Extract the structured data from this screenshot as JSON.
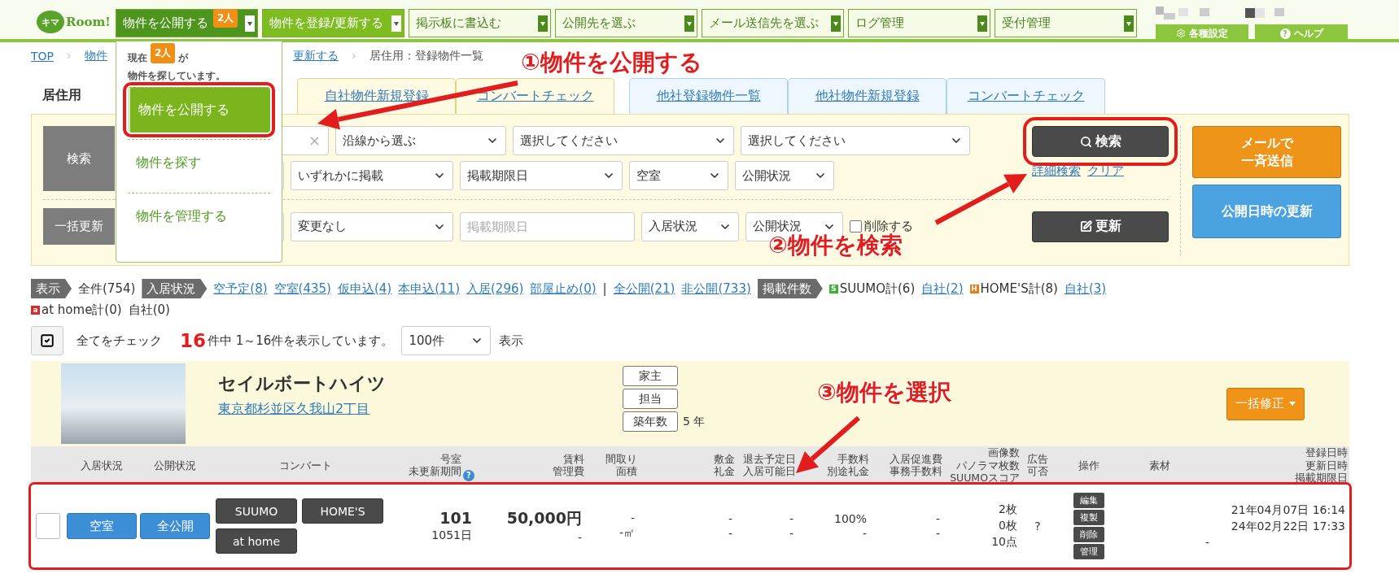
{
  "logo": {
    "mark": "キマ",
    "word": "Room!"
  },
  "nav": [
    {
      "label": "物件を公開する",
      "kind": "solid",
      "selected": true,
      "badge": "2人"
    },
    {
      "label": "物件を登録/更新する",
      "kind": "solid",
      "selected": false
    },
    {
      "label": "掲示板に書込む",
      "kind": "outline",
      "selected": false
    },
    {
      "label": "公開先を選ぶ",
      "kind": "outline",
      "selected": false
    },
    {
      "label": "メール送信先を選ぶ",
      "kind": "outline",
      "selected": false
    },
    {
      "label": "ログ管理",
      "kind": "outline",
      "selected": false
    },
    {
      "label": "受付管理",
      "kind": "outline",
      "selected": false
    }
  ],
  "utility": [
    {
      "label": "各種設定",
      "kind": "settings"
    },
    {
      "label": "ヘルプ",
      "kind": "help",
      "icon": "?"
    }
  ],
  "dropdown": {
    "status_before": "現在",
    "badge": "2人",
    "status_after": "が",
    "status_line2": "物件を探しています。",
    "items": [
      {
        "label": "物件を公開する",
        "selected": true,
        "highlighted": true
      },
      {
        "label": "物件を探す",
        "selected": false,
        "highlighted": false
      },
      {
        "label": "物件を管理する",
        "selected": false,
        "highlighted": false
      }
    ]
  },
  "breadcrumb": [
    {
      "label": "TOP",
      "kind": "link"
    },
    {
      "label": "物件",
      "kind": "link"
    },
    {
      "label": "更新する",
      "kind": "link"
    },
    {
      "label": "居住用：登録物件一覧",
      "kind": "current"
    }
  ],
  "section_title": "居住用",
  "tabs": [
    {
      "label": "自社物件新規登録",
      "kind": "own"
    },
    {
      "label": "コンバートチェック",
      "kind": "own"
    },
    {
      "label": "他社登録物件一覧",
      "kind": "other"
    },
    {
      "label": "他社物件新規登録",
      "kind": "other"
    },
    {
      "label": "コンバートチェック",
      "kind": "other"
    }
  ],
  "search": {
    "label": "検索",
    "rows": [
      {
        "fields": [
          {
            "kind": "clearable"
          },
          {
            "kind": "select",
            "value": "沿線から選ぶ"
          },
          {
            "kind": "select",
            "value": "選択してください"
          },
          {
            "kind": "select",
            "value": "選択してください"
          }
        ]
      },
      {
        "fields": [
          {
            "kind": "select"
          },
          {
            "kind": "select",
            "value": "いずれかに掲載"
          },
          {
            "kind": "select",
            "value": "掲載期限日"
          },
          {
            "kind": "select",
            "value": "空室"
          },
          {
            "kind": "select",
            "value": "公開状況"
          }
        ]
      }
    ],
    "button": {
      "label": "検索",
      "highlighted": true
    },
    "links": [
      "詳細検索",
      "クリア"
    ]
  },
  "bulk": {
    "label": "一括更新",
    "fields": [
      {
        "kind": "select"
      },
      {
        "kind": "select",
        "value": "変更なし"
      },
      {
        "kind": "date",
        "placeholder": "掲載期限日"
      },
      {
        "kind": "select",
        "value": "入居状況"
      },
      {
        "kind": "select",
        "value": "公開状況"
      },
      {
        "kind": "checkbox",
        "label": "削除する",
        "checked": false
      }
    ],
    "button": {
      "label": "更新"
    }
  },
  "mail_button": {
    "lines": [
      "メールで",
      "一斉送信"
    ]
  },
  "publish_date_button": {
    "label": "公開日時の更新"
  },
  "status_lines": [
    [
      {
        "kind": "tag",
        "text": "表示"
      },
      {
        "kind": "text",
        "text": "全件(754)"
      },
      {
        "kind": "tag",
        "text": "入居状況"
      },
      {
        "kind": "link",
        "text": "空予定(8)"
      },
      {
        "kind": "link",
        "text": "空室(435)"
      },
      {
        "kind": "link",
        "text": "仮申込(4)"
      },
      {
        "kind": "link",
        "text": "本申込(11)"
      },
      {
        "kind": "link",
        "text": "入居(296)"
      },
      {
        "kind": "link",
        "text": "部屋止め(0)"
      },
      {
        "kind": "divider",
        "text": "|"
      },
      {
        "kind": "link",
        "text": "全公開(21)"
      },
      {
        "kind": "link",
        "text": "非公開(733)"
      },
      {
        "kind": "tag",
        "text": "掲載件数"
      },
      {
        "kind": "source",
        "icon": "S",
        "color": "#3cb034",
        "text": "SUUMO計(6)"
      },
      {
        "kind": "link",
        "text": "自社(2)"
      },
      {
        "kind": "source",
        "icon": "H",
        "color": "#ee7a14",
        "text": "HOME'S計(8)"
      },
      {
        "kind": "link",
        "text": "自社(3)"
      }
    ],
    [
      {
        "kind": "source",
        "icon": "a",
        "color": "#d52b2b",
        "text": "at home計(0)"
      },
      {
        "kind": "text",
        "text": "自社(0)"
      }
    ]
  ],
  "check_all": {
    "label": "全てをチェック"
  },
  "count": "16",
  "count_text": "件中 1～16件を表示しています。",
  "per_page": "100件",
  "per_page_suffix": "表示",
  "property": {
    "name": "セイルボートハイツ",
    "address": "東京都杉並区久我山2丁目",
    "tags": [
      {
        "label": "家主"
      },
      {
        "label": "担当"
      },
      {
        "label": "築年数",
        "value": "5 年"
      }
    ],
    "bulk_edit": "一括修正"
  },
  "table": {
    "columns": [
      {
        "lines": [
          "入居状況"
        ]
      },
      {
        "lines": [
          "公開状況"
        ]
      },
      {
        "lines": [
          "コンバート"
        ]
      },
      {
        "lines": [
          "号室",
          "未更新期間"
        ],
        "help": "?"
      },
      {
        "lines": [
          "賃料",
          "管理費"
        ]
      },
      {
        "lines": [
          "間取り",
          "面積"
        ]
      },
      {
        "lines": [
          "敷金",
          "礼金"
        ]
      },
      {
        "lines": [
          "退去予定日",
          "入居可能日"
        ]
      },
      {
        "lines": [
          "手数料",
          "別途礼金"
        ]
      },
      {
        "lines": [
          "入居促進費",
          "事務手数料"
        ]
      },
      {
        "lines": [
          "画像数",
          "パノラマ枚数",
          "SUUMOスコア"
        ]
      },
      {
        "lines": [
          "広告",
          "可否"
        ]
      },
      {
        "lines": [
          "操作"
        ]
      },
      {
        "lines": [
          "素材"
        ]
      },
      {
        "lines": [
          "登録日時",
          "更新日時",
          "掲載期限日"
        ]
      }
    ],
    "rows": [
      {
        "checked": false,
        "highlighted": true,
        "occupancy": "空室",
        "publication": "全公開",
        "convert": [
          "SUUMO",
          "HOME'S",
          "at home"
        ],
        "room": "101",
        "room_age": "1051日",
        "rent": "50,000円",
        "management_fee": "-",
        "layout": "-",
        "area": "-㎡",
        "deposit": "-",
        "key_money": "-",
        "move_out": "-",
        "move_in": "-",
        "fee": "100%",
        "extra_key_money": "-",
        "promo": "-",
        "office_fee": "-",
        "images": [
          "2枚",
          "0枚",
          "10点"
        ],
        "ad": "?",
        "actions": [
          "編集",
          "複製",
          "削除",
          "管理"
        ],
        "dates": [
          "21年04月07日 16:14",
          "24年02月22日 17:33",
          "-"
        ]
      }
    ]
  },
  "annotations": [
    {
      "text": "①物件を公開する"
    },
    {
      "text": "②物件を検索"
    },
    {
      "text": "③物件を選択"
    }
  ]
}
